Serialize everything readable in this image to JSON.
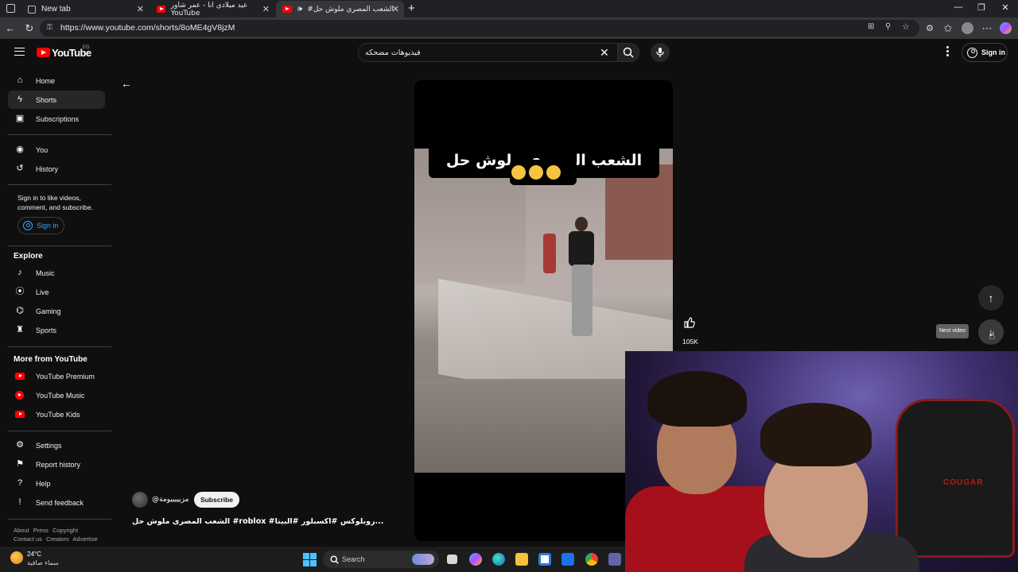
{
  "browser": {
    "tabs": [
      {
        "label": "New tab",
        "icon": "new-tab-icon"
      },
      {
        "label": "عيد ميلادي انا - عمر شاور YouTube",
        "icon": "youtube-icon"
      },
      {
        "label": "#الشعب المصري ملوش حل",
        "icon": "youtube-icon"
      }
    ],
    "url": "https://www.youtube.com/shorts/8oME4gV8jzM"
  },
  "header": {
    "logo_text": "YouTube",
    "country": "EG",
    "search_value": "فيديوهات مضحكه",
    "signin_label": "Sign in"
  },
  "sidebar": {
    "main": [
      {
        "label": "Home",
        "icon": "home-icon"
      },
      {
        "label": "Shorts",
        "icon": "shorts-icon"
      },
      {
        "label": "Subscriptions",
        "icon": "subscriptions-icon"
      }
    ],
    "you": [
      {
        "label": "You",
        "icon": "you-icon"
      },
      {
        "label": "History",
        "icon": "history-icon"
      }
    ],
    "signin_note": "Sign in to like videos, comment, and subscribe.",
    "signin_label": "Sign in",
    "explore_title": "Explore",
    "explore": [
      {
        "label": "Music",
        "icon": "music-icon"
      },
      {
        "label": "Live",
        "icon": "live-icon"
      },
      {
        "label": "Gaming",
        "icon": "gaming-icon"
      },
      {
        "label": "Sports",
        "icon": "sports-icon"
      }
    ],
    "more_title": "More from YouTube",
    "more": [
      {
        "label": "YouTube Premium",
        "icon": "youtube-premium-icon"
      },
      {
        "label": "YouTube Music",
        "icon": "youtube-music-icon"
      },
      {
        "label": "YouTube Kids",
        "icon": "youtube-kids-icon"
      }
    ],
    "settings": [
      {
        "label": "Settings",
        "icon": "settings-icon"
      },
      {
        "label": "Report history",
        "icon": "flag-icon"
      },
      {
        "label": "Help",
        "icon": "help-icon"
      },
      {
        "label": "Send feedback",
        "icon": "feedback-icon"
      }
    ],
    "footer1": [
      "About",
      "Press",
      "Copyright"
    ],
    "footer2": [
      "Contact us",
      "Creators",
      "Advertise"
    ]
  },
  "video": {
    "caption_line1": "الشعب المصري ملوش حل",
    "like_count": "105K",
    "next_tooltip": "Next video",
    "channel_name": "@مزيييييومة",
    "subscribe_label": "Subscribe",
    "title": "الشعب المصرى ملوش حل #roblox #روبلوكس #اكسبلور #البيتا..."
  },
  "webcam": {
    "chair_brand": "COUGAR"
  },
  "taskbar": {
    "temperature": "24°C",
    "weather_desc": "سماء صافية",
    "search_label": "Search"
  },
  "colors": {
    "youtube_red": "#ff0000",
    "background": "#0f0f0f",
    "link_blue": "#3ea6ff"
  }
}
